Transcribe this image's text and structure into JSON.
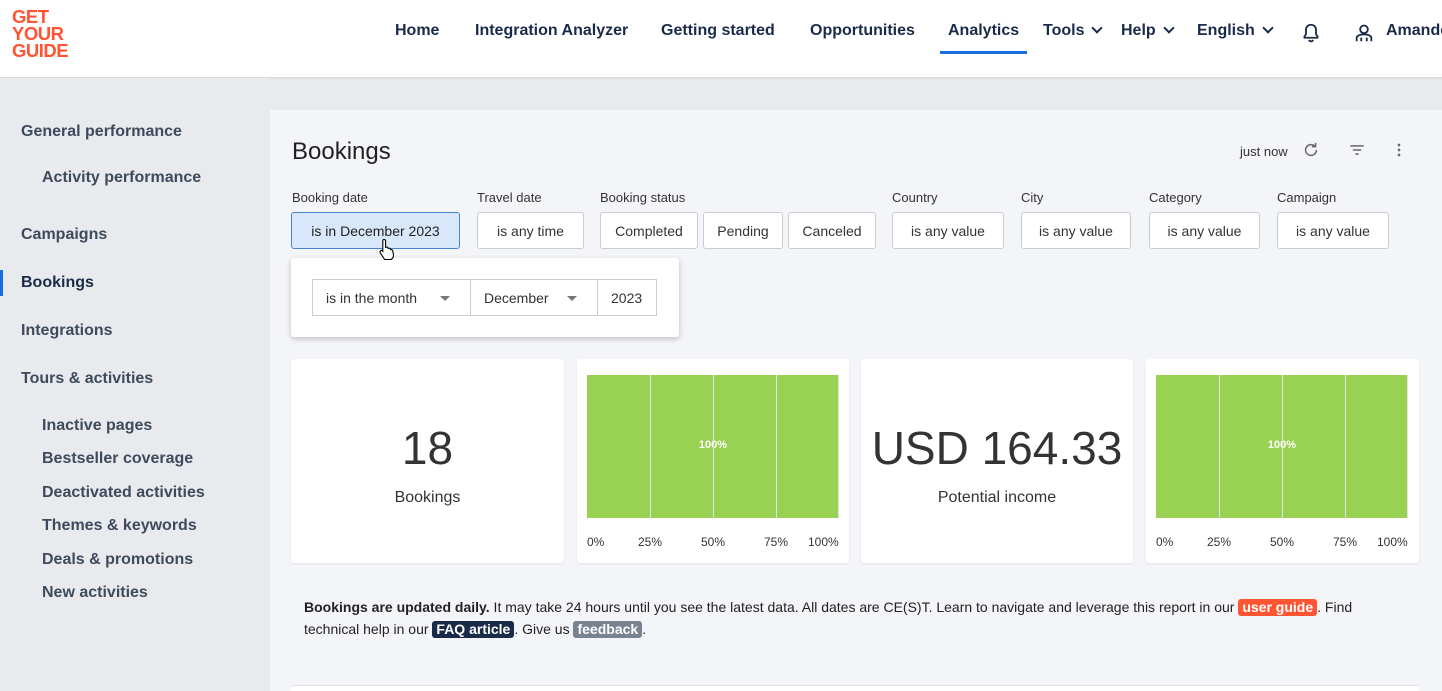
{
  "brand": {
    "logo_lines": [
      "GET",
      "YOUR",
      "GUIDE"
    ],
    "accent": "#ff5533",
    "link_color": "#1a6ee0",
    "bar_color": "#99d152"
  },
  "nav": {
    "items": [
      "Home",
      "Integration Analyzer",
      "Getting started",
      "Opportunities",
      "Analytics",
      "Tools",
      "Help",
      "English"
    ],
    "active": "Analytics",
    "user": "Amande",
    "icons": [
      "bell-icon",
      "user-icon"
    ]
  },
  "sidebar": {
    "items": [
      {
        "label": "General performance"
      },
      {
        "label": "Activity performance"
      },
      {
        "label": "Campaigns"
      },
      {
        "label": "Bookings"
      },
      {
        "label": "Integrations"
      },
      {
        "label": "Tours & activities"
      },
      {
        "label": "Inactive pages"
      },
      {
        "label": "Bestseller coverage"
      },
      {
        "label": "Deactivated activities"
      },
      {
        "label": "Themes & keywords"
      },
      {
        "label": "Deals & promotions"
      },
      {
        "label": "New activities"
      }
    ],
    "active": "Bookings"
  },
  "page": {
    "title": "Bookings",
    "refreshed": "just now",
    "toolbar_icons": [
      "refresh-icon",
      "filter-icon",
      "more-vert-icon"
    ]
  },
  "filters": {
    "booking_date": {
      "label": "Booking date",
      "value": "is in December 2023"
    },
    "travel_date": {
      "label": "Travel date",
      "value": "is any time"
    },
    "booking_status": {
      "label": "Booking status",
      "options": [
        "Completed",
        "Pending",
        "Canceled"
      ]
    },
    "country": {
      "label": "Country",
      "value": "is any value"
    },
    "city": {
      "label": "City",
      "value": "is any value"
    },
    "category": {
      "label": "Category",
      "value": "is any value"
    },
    "campaign": {
      "label": "Campaign",
      "value": "is any value"
    }
  },
  "date_popup": {
    "mode": "is in the month",
    "month": "December",
    "year": "2023"
  },
  "kpis": [
    {
      "value": "18",
      "label": "Bookings"
    },
    {
      "value": "USD 164.33",
      "label": "Potential income"
    }
  ],
  "chart_data": [
    {
      "type": "bar",
      "orientation": "horizontal",
      "values": [
        100
      ],
      "data_label": "100%",
      "ticks": [
        "0%",
        "25%",
        "50%",
        "75%",
        "100%"
      ],
      "xlim": [
        0,
        100
      ]
    },
    {
      "type": "bar",
      "orientation": "horizontal",
      "values": [
        100
      ],
      "data_label": "100%",
      "ticks": [
        "0%",
        "25%",
        "50%",
        "75%",
        "100%"
      ],
      "xlim": [
        0,
        100
      ]
    }
  ],
  "info": {
    "bold": "Bookings are updated daily.",
    "text1": " It may take 24 hours until you see the latest data. All dates are CE(S)T. Learn to navigate and leverage this report in our ",
    "link1": "user guide",
    "text2": ". Find technical help in our ",
    "link2": "FAQ article",
    "text3": ". Give us ",
    "link3": "feedback",
    "text4": "."
  }
}
